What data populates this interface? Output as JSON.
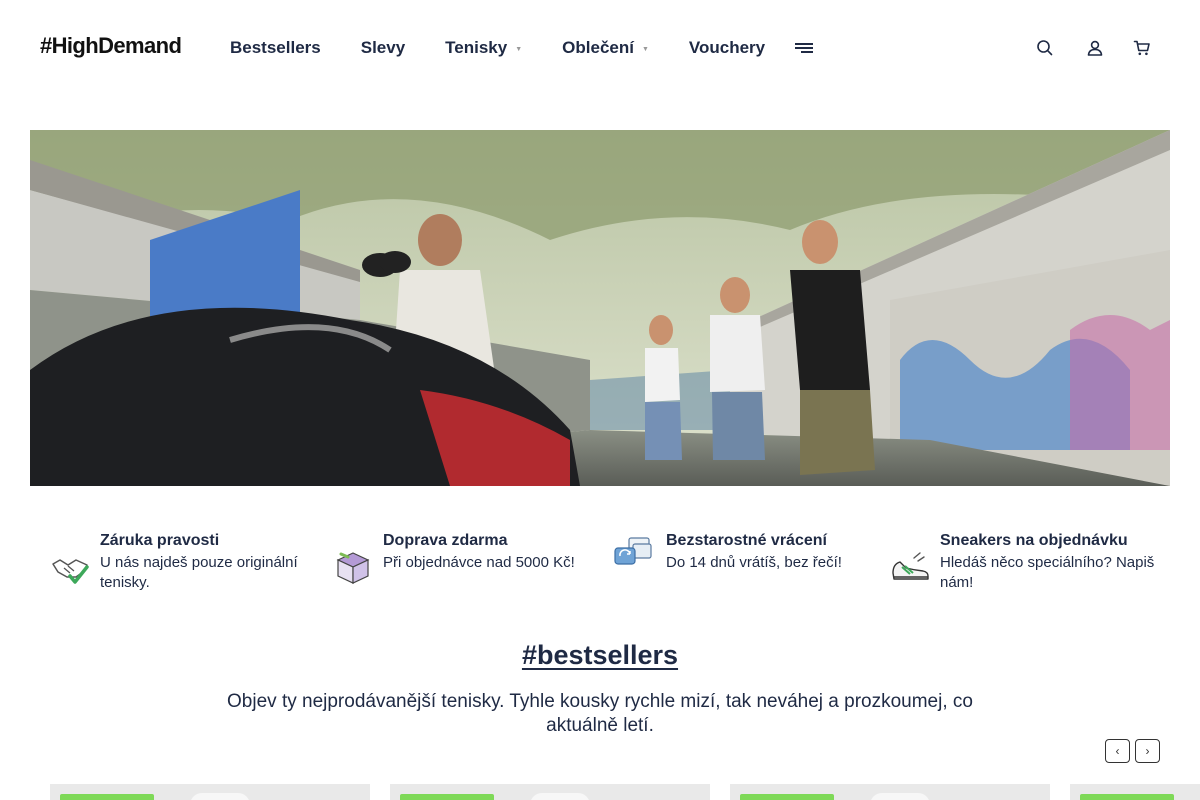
{
  "header": {
    "logo": "#HighDemand",
    "nav": [
      {
        "label": "Bestsellers",
        "has_dropdown": false
      },
      {
        "label": "Slevy",
        "has_dropdown": false
      },
      {
        "label": "Tenisky",
        "has_dropdown": true
      },
      {
        "label": "Oblečení",
        "has_dropdown": true
      },
      {
        "label": "Vouchery",
        "has_dropdown": false
      }
    ],
    "icons": [
      "menu-icon",
      "search-icon",
      "user-icon",
      "cart-icon"
    ]
  },
  "hero": {
    "image": "street-scene-photo"
  },
  "features": [
    {
      "icon": "handshake-icon",
      "title": "Záruka pravosti",
      "desc": "U nás najdeš pouze originální tenisky."
    },
    {
      "icon": "box-icon",
      "title": "Doprava zdarma",
      "desc": "Při objednávce nad 5000 Kč!"
    },
    {
      "icon": "return-icon",
      "title": "Bezstarostné vrácení",
      "desc": "Do 14 dnů vrátíš, bez řečí!"
    },
    {
      "icon": "sneaker-icon",
      "title": "Sneakers na objednávku",
      "desc": "Hledáš něco speciálního? Napiš nám!"
    }
  ],
  "bestsellers": {
    "title": "#bestsellers",
    "desc": "Objev ty nejprodávanější tenisky. Tyhle kousky rychle mizí, tak neváhej a prozkoumej, co aktuálně letí.",
    "prev": "‹",
    "next": "›"
  },
  "colors": {
    "text": "#1f2a44",
    "badge": "#7ed957",
    "card_bg": "#e9e9e9"
  }
}
